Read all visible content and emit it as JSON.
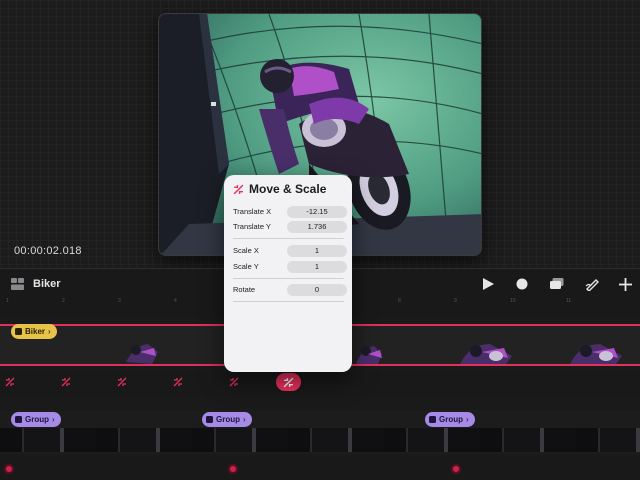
{
  "viewer": {
    "timecode": "00:00:02.018"
  },
  "toolbar": {
    "title": "Biker",
    "icons": [
      "layers-icon",
      "play-icon",
      "record-icon",
      "stack-icon",
      "pen-icon",
      "plus-icon"
    ]
  },
  "ruler": {
    "ticks": [
      "1",
      "2",
      "3",
      "4",
      "5",
      "6",
      "7",
      "8",
      "9",
      "10",
      "11"
    ]
  },
  "tracks": {
    "biker_tag": "Biker",
    "group_tags": [
      "Group",
      "Group",
      "Group"
    ]
  },
  "popup": {
    "title": "Move & Scale",
    "translate_x_label": "Translate X",
    "translate_x_value": "-12.15",
    "translate_y_label": "Translate Y",
    "translate_y_value": "1.736",
    "scale_x_label": "Scale X",
    "scale_x_value": "1",
    "scale_y_label": "Scale Y",
    "scale_y_value": "1",
    "rotate_label": "Rotate",
    "rotate_value": "0"
  },
  "colors": {
    "accent": "#e8305e",
    "biker_tag": "#e8c34a",
    "group_tag": "#a58ae6",
    "preview_bg": "#5aa58a"
  }
}
